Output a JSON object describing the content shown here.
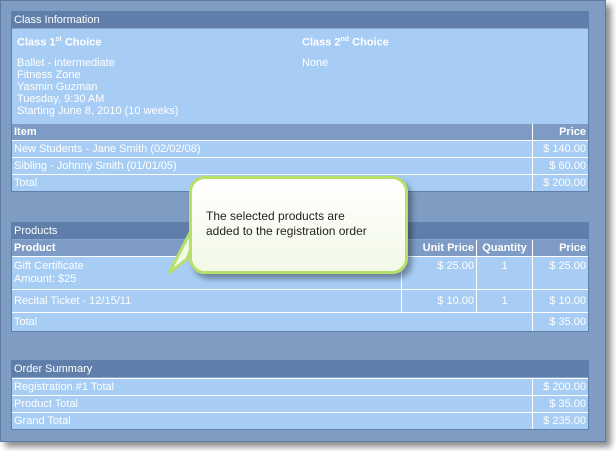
{
  "class_info": {
    "header": "Class Information",
    "choice1_title_pre": "Class 1",
    "choice1_title_sup": "st",
    "choice1_title_post": " Choice",
    "choice1_lines": [
      "Ballet - intermediate",
      "Fitness Zone",
      "Yasmin Guzman",
      "Tuesday, 9:30 AM",
      "Starting June 8, 2010 (10 weeks)"
    ],
    "choice2_title_pre": "Class 2",
    "choice2_title_sup": "nd",
    "choice2_title_post": " Choice",
    "choice2_value": "None",
    "col_item": "Item",
    "col_price": "Price",
    "rows": [
      {
        "item": "New Students - Jane Smith (02/02/08)",
        "price": "$ 140.00"
      },
      {
        "item": "Sibling - Johnny Smith (01/01/05)",
        "price": "$ 60.00"
      }
    ],
    "total_label": "Total",
    "total_value": "$ 200.00"
  },
  "products": {
    "header": "Products",
    "col_product": "Product",
    "col_unit_price": "Unit Price",
    "col_quantity": "Quantity",
    "col_price": "Price",
    "rows": [
      {
        "product": "Gift Certificate",
        "detail": "Amount: $25",
        "unit_price": "$ 25.00",
        "quantity": "1",
        "price": "$ 25.00"
      },
      {
        "product": "Recital Ticket - 12/15/11",
        "unit_price": "$ 10.00",
        "quantity": "1",
        "price": "$ 10.00"
      }
    ],
    "total_label": "Total",
    "total_value": "$ 35.00"
  },
  "order_summary": {
    "header": "Order Summary",
    "rows": [
      {
        "label": "Registration #1 Total",
        "value": "$ 200.00"
      },
      {
        "label": "Product Total",
        "value": "$ 35.00"
      },
      {
        "label": "Grand Total",
        "value": "$ 235.00"
      }
    ]
  },
  "callout": {
    "line1": "The selected products are",
    "line2": "added to the registration order"
  },
  "colors": {
    "frame": "#7f9cc3",
    "panel": "#a8cdf4",
    "panel_header": "#5f7ea9",
    "column_header": "#7d9bc4",
    "callout_border": "#b7e06a"
  }
}
